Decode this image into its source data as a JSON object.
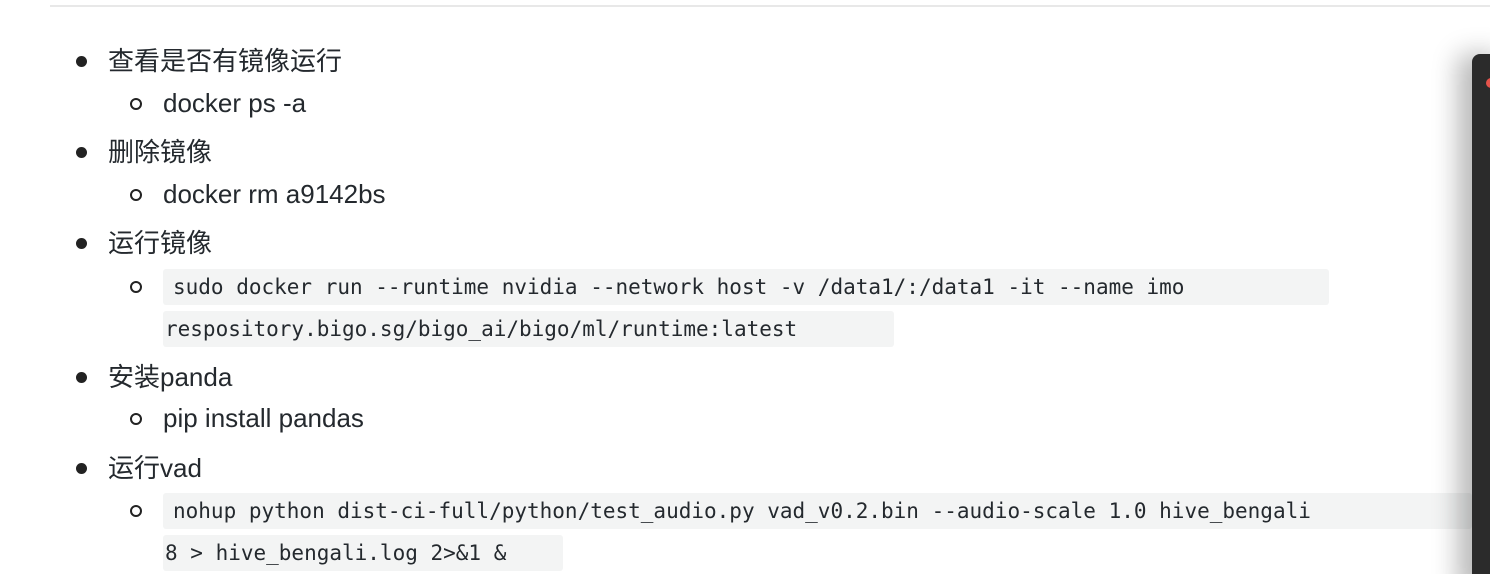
{
  "items": [
    {
      "label": "查看是否有镜像运行",
      "sub": "docker ps -a"
    },
    {
      "label": "删除镜像",
      "sub": "docker rm a9142bs"
    },
    {
      "label": "运行镜像",
      "code_line1": "sudo docker run --runtime nvidia --network host -v /data1/:/data1 -it --name imo",
      "code_line2": "respository.bigo.sg/bigo_ai/bigo/ml/runtime:latest"
    },
    {
      "label": "安装panda",
      "sub": "pip install pandas"
    },
    {
      "label": "运行vad",
      "code_line1": "nohup python dist-ci-full/python/test_audio.py vad_v0.2.bin --audio-scale 1.0 hive_bengali",
      "code_line2": "8 > hive_bengali.log 2>&1 &"
    }
  ]
}
